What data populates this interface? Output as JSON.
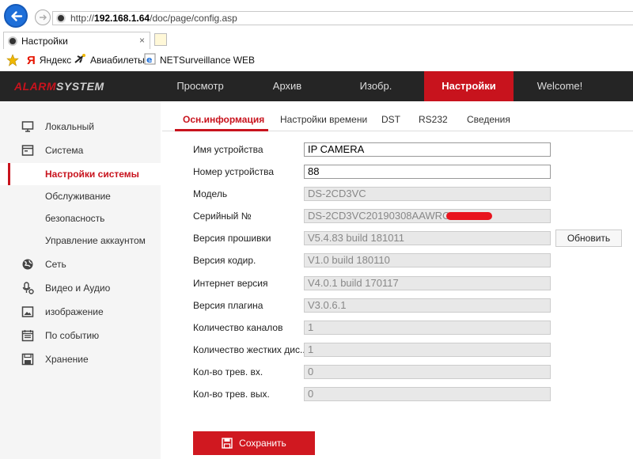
{
  "browser": {
    "url_prefix": "http://",
    "url_host": "192.168.1.64",
    "url_path": "/doc/page/config.asp",
    "tab_title": "Настройки",
    "tab_close": "×",
    "favorites": [
      {
        "icon": "yandex-icon",
        "label": "Яндекс"
      },
      {
        "icon": "plane-icon",
        "label": "Авиабилеты"
      },
      {
        "icon": "ie-page-icon",
        "label": "NETSurveillance WEB"
      }
    ]
  },
  "app": {
    "logo_red": "ALARM",
    "logo_rest": "SYSTEM",
    "nav": [
      {
        "label": "Просмотр"
      },
      {
        "label": "Архив"
      },
      {
        "label": "Изобр."
      },
      {
        "label": "Настройки"
      },
      {
        "label": "Welcome!"
      }
    ]
  },
  "sidebar": {
    "items": [
      {
        "label": "Локальный",
        "icon": "monitor-icon"
      },
      {
        "label": "Система",
        "icon": "system-icon"
      },
      {
        "label": "Настройки системы"
      },
      {
        "label": "Обслуживание"
      },
      {
        "label": "безопасность"
      },
      {
        "label": "Управление аккаунтом"
      },
      {
        "label": "Сеть",
        "icon": "globe-icon"
      },
      {
        "label": "Видео и Аудио",
        "icon": "microphone-icon"
      },
      {
        "label": "изображение",
        "icon": "image-icon"
      },
      {
        "label": "По событию",
        "icon": "calendar-icon"
      },
      {
        "label": "Хранение",
        "icon": "storage-icon"
      }
    ]
  },
  "content": {
    "tabs": [
      {
        "label": "Осн.информация"
      },
      {
        "label": "Настройки времени"
      },
      {
        "label": "DST"
      },
      {
        "label": "RS232"
      },
      {
        "label": "Сведения"
      }
    ],
    "fields": [
      {
        "label": "Имя устройства",
        "value": "IP CAMERA"
      },
      {
        "label": "Номер устройства",
        "value": "88"
      },
      {
        "label": "Модель",
        "value": "DS-2CD3VC"
      },
      {
        "label": "Серийный №",
        "value": "DS-2CD3VC20190308AAWRC"
      },
      {
        "label": "Версия прошивки",
        "value": "V5.4.83 build 181011"
      },
      {
        "label": "Версия кодир.",
        "value": "V1.0 build 180110"
      },
      {
        "label": "Интернет версия",
        "value": "V4.0.1 build 170117"
      },
      {
        "label": "Версия плагина",
        "value": "V3.0.6.1"
      },
      {
        "label": "Количество каналов",
        "value": "1"
      },
      {
        "label": "Количество жестких дис...",
        "value": "1"
      },
      {
        "label": "Кол-во трев. вх.",
        "value": "0"
      },
      {
        "label": "Кол-во трев. вых.",
        "value": "0"
      }
    ],
    "update_button": "Обновить",
    "save_button": "Сохранить"
  },
  "colors": {
    "accent": "#c8131d",
    "header_bg": "#252525",
    "browser_back": "#1e6fd9"
  }
}
